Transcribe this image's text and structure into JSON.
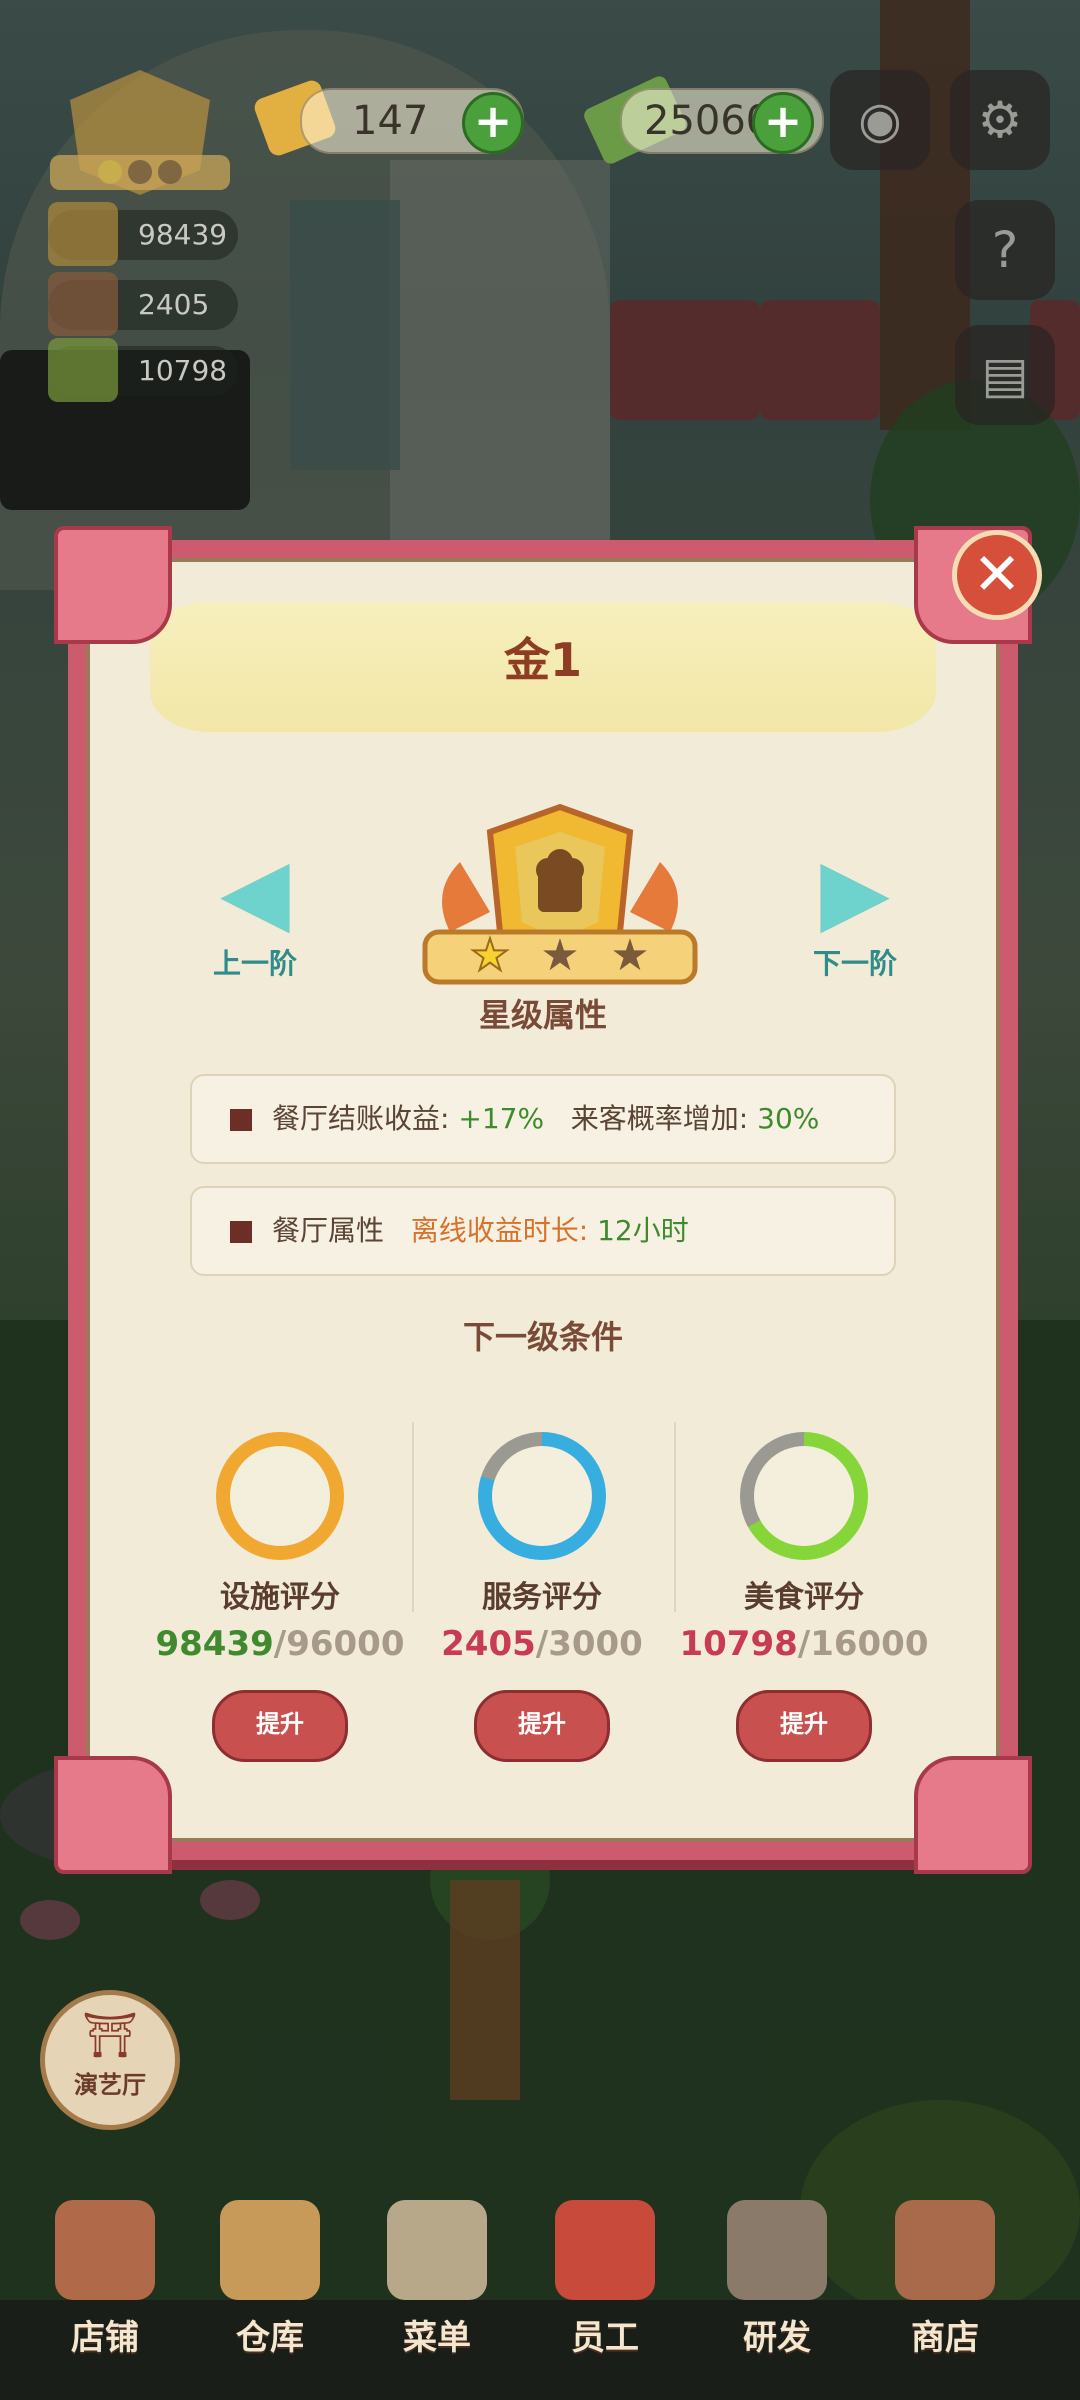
{
  "hud": {
    "gems": "147",
    "cash": "25060",
    "facility_score": "98439",
    "service_score": "2405",
    "food_score": "10798"
  },
  "dialog": {
    "title": "金1",
    "prev_label": "上一阶",
    "next_label": "下一阶",
    "attributes_heading": "星级属性",
    "attr_row1_label": "餐厅结账收益",
    "attr_row1_value": "+17%",
    "attr_row1_label2": "来客概率增加",
    "attr_row1_value2": "30%",
    "attr_row2_label": "餐厅属性",
    "attr_row2_label2": "离线收益时长",
    "attr_row2_value2": "12小时",
    "conditions_heading": "下一级条件",
    "requirements": [
      {
        "name": "设施评分",
        "current": "98439",
        "target": "96000",
        "color": "#3f8a2e",
        "ring": "#f0a830",
        "progress": 1.0
      },
      {
        "name": "服务评分",
        "current": "2405",
        "target": "3000",
        "color": "#c83b52",
        "ring": "#38aee0",
        "progress": 0.8
      },
      {
        "name": "美食评分",
        "current": "10798",
        "target": "16000",
        "color": "#c83b52",
        "ring": "#86d63a",
        "progress": 0.67
      }
    ],
    "upgrade_label": "提升",
    "stars_earned": 1,
    "stars_total": 3
  },
  "side_button": "演艺厅",
  "tabs": [
    {
      "label": "店铺",
      "color": "#b06a4a"
    },
    {
      "label": "仓库",
      "color": "#c89a5a"
    },
    {
      "label": "菜单",
      "color": "#b8a88a"
    },
    {
      "label": "员工",
      "color": "#c84a3a"
    },
    {
      "label": "研发",
      "color": "#8a7a6a"
    },
    {
      "label": "商店",
      "color": "#a86a4a"
    }
  ],
  "colors": {
    "dialog_frame": "#cc5b6e",
    "dialog_bg": "#f2ebd8",
    "title": "#8f3c24",
    "nav": "#2f8c8a",
    "upgrade_button": "#c8504f"
  }
}
